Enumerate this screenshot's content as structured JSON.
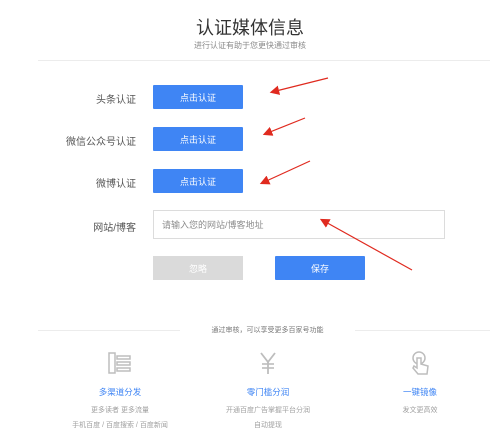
{
  "header": {
    "title": "认证媒体信息",
    "subtitle": "进行认证有助于您更快通过审核"
  },
  "rows": [
    {
      "label": "头条认证",
      "button": "点击认证"
    },
    {
      "label": "微信公众号认证",
      "button": "点击认证"
    },
    {
      "label": "微博认证",
      "button": "点击认证"
    }
  ],
  "website": {
    "label": "网站/博客",
    "placeholder": "请输入您的网站/博客地址"
  },
  "actions": {
    "skip": "忽略",
    "save": "保存"
  },
  "benefits": {
    "separator_text": "通过审核，可以享受更多百家号功能",
    "items": [
      {
        "icon": "multi-channel-icon",
        "title": "多渠道分发",
        "line1": "更多读者 更多流量",
        "line2": "手机百度 / 百度搜索 / 百度新闻"
      },
      {
        "icon": "yen-icon",
        "title": "零门槛分润",
        "line1": "开通百度广告掌握平台分润",
        "line2": "自动提现"
      },
      {
        "icon": "tap-icon",
        "title": "一键镜像",
        "line1": "发文更高效",
        "line2": ""
      }
    ]
  },
  "colors": {
    "accent": "#3f85f4",
    "arrow": "#e02a1f",
    "disabled": "#dadada"
  }
}
